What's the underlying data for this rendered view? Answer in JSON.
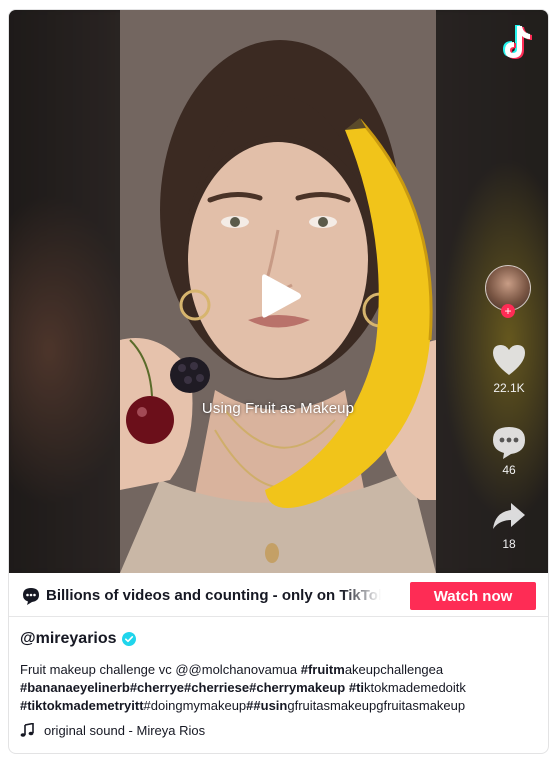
{
  "video": {
    "caption": "Using Fruit as Makeup",
    "likes": "22.1K",
    "comments": "46",
    "shares": "18"
  },
  "promo": {
    "text": "Billions of videos and counting - only on TikTok",
    "button_label": "Watch now"
  },
  "post": {
    "username": "@mireyarios",
    "description_segments": [
      {
        "text": "Fruit makeup challenge vc @@molchanovamua ",
        "bold": false
      },
      {
        "text": "#fruitm",
        "bold": true
      },
      {
        "text": "akeupchallengea ",
        "bold": false
      },
      {
        "text": "#bananaeyelinerb",
        "bold": true
      },
      {
        "text": "#cherrye",
        "bold": true
      },
      {
        "text": "#cherriese",
        "bold": true
      },
      {
        "text": "#cherrymakeup",
        "bold": true
      },
      {
        "text": " ",
        "bold": false
      },
      {
        "text": "#ti",
        "bold": true
      },
      {
        "text": "ktokmademedoitk ",
        "bold": false
      },
      {
        "text": "#tiktokmademetryitt",
        "bold": true
      },
      {
        "text": "#doingmymakeup",
        "bold": false
      },
      {
        "text": "##usin",
        "bold": true
      },
      {
        "text": "gfruitasmakeupgfruitasmakeup",
        "bold": false
      }
    ],
    "sound": "original sound - Mireya Rios"
  },
  "colors": {
    "accent": "#fe2c55",
    "verified": "#20d5ec",
    "text": "#161823"
  },
  "icons": [
    "tiktok-logo-icon",
    "play-icon",
    "heart-icon",
    "comment-icon",
    "share-icon",
    "chat-bubble-icon",
    "verified-badge-icon",
    "music-note-icon",
    "plus-icon"
  ]
}
